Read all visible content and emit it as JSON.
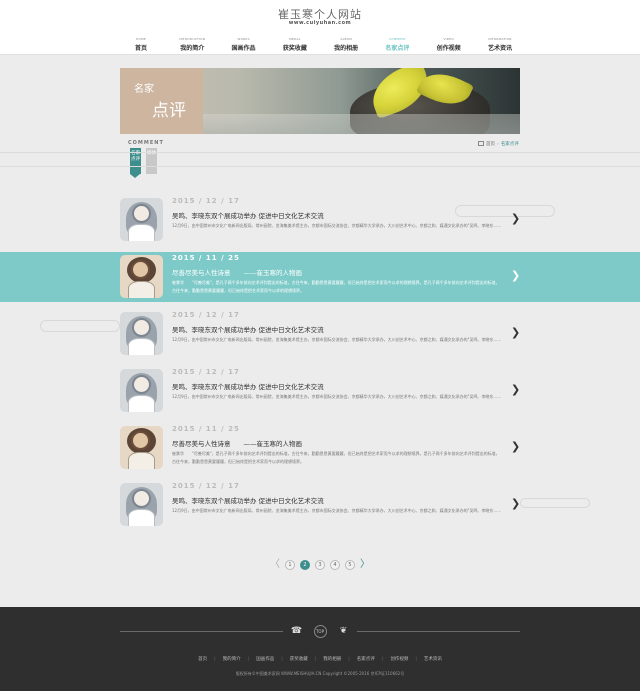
{
  "header": {
    "title": "崔玉寒个人网站",
    "url": "www.cuiyuhan.com",
    "nav": [
      {
        "en": "HOME",
        "cn": "首页",
        "active": false
      },
      {
        "en": "INTRODUCTION",
        "cn": "我的简介",
        "active": false
      },
      {
        "en": "WORKS",
        "cn": "国画作品",
        "active": false
      },
      {
        "en": "MEDAL",
        "cn": "获奖收藏",
        "active": false
      },
      {
        "en": "ALBUM",
        "cn": "我的相册",
        "active": false
      },
      {
        "en": "COMMENT",
        "cn": "名家点评",
        "active": true
      },
      {
        "en": "VIDEO",
        "cn": "创作视频",
        "active": false
      },
      {
        "en": "INFORMATION",
        "cn": "艺术资讯",
        "active": false
      }
    ]
  },
  "banner": {
    "line1": "名家",
    "line2": "点评"
  },
  "subheader": {
    "section_en": "COMMENT",
    "tab_active": "名家点评",
    "tab_other": "媒体"
  },
  "breadcrumb": {
    "home": "首页",
    "current": "名家点评"
  },
  "items": [
    {
      "date": "2015 / 12 / 17",
      "title": "吴鸣、李晓东双个展成功举办 促进中日文化艺术交流",
      "desc": "12月9日，由中国常州市文化广电新闻出版局、常州画院、览海集美术馆主办，京都市国际交流协会、京都精华大学承办，大川创艺术中心、京都之和、媒通文化承办的\"吴鸣、李晓东......",
      "style": "lady",
      "highlight": false
    },
    {
      "date": "2015 / 11 / 25",
      "title": "尽善尽美与人性诗意　　——崔玉寒的人物画",
      "desc": "崔景华　　\"尽善尽美\"，是孔子两千多年前向艺术评判提出的标准，古往今来，勤勤恳恳黄要履履，但已始终是把艺术家而今以求的理想境界。是孔子两千多年前向艺术评判提出的标准，古往今来，勤勤恳恳黄要履履，但已始终是把艺术家而今以求的理想境界。",
      "style": "old",
      "highlight": true
    },
    {
      "date": "2015 / 12 / 17",
      "title": "吴鸣、李晓东双个展成功举办 促进中日文化艺术交流",
      "desc": "12月9日，由中国常州市文化广电新闻出版局、常州画院、览海集美术馆主办，京都市国际交流协会、京都精华大学承办，大川创艺术中心、京都之和、媒通文化承办的\"吴鸣、李晓东......",
      "style": "lady",
      "highlight": false
    },
    {
      "date": "2015 / 12 / 17",
      "title": "吴鸣、李晓东双个展成功举办 促进中日文化艺术交流",
      "desc": "12月9日，由中国常州市文化广电新闻出版局、常州画院、览海集美术馆主办，京都市国际交流协会、京都精华大学承办，大川创艺术中心、京都之和、媒通文化承办的\"吴鸣、李晓东......",
      "style": "lady",
      "highlight": false
    },
    {
      "date": "2015 / 11 / 25",
      "title": "尽善尽美与人性诗意　　——崔玉寒的人物画",
      "desc": "崔景华　　\"尽善尽美\"，是孔子两千多年前向艺术评判提出的标准，古往今来，勤勤恳恳黄要履履，但已始终是把艺术家而今以求的理想境界。是孔子两千多年前向艺术评判提出的标准，古往今来，勤勤恳恳黄要履履，但已始终是把艺术家而今以求的理想境界。",
      "style": "old",
      "highlight": false
    },
    {
      "date": "2015 / 12 / 17",
      "title": "吴鸣、李晓东双个展成功举办 促进中日文化艺术交流",
      "desc": "12月9日，由中国常州市文化广电新闻出版局、常州画院、览海集美术馆主办，京都市国际交流协会、京都精华大学承办，大川创艺术中心、京都之和、媒通文化承办的\"吴鸣、李晓东......",
      "style": "lady",
      "highlight": false
    }
  ],
  "pager": {
    "prev": "〈",
    "next": "〉",
    "pages": [
      "1",
      "2",
      "3",
      "4",
      "5"
    ],
    "current": "2"
  },
  "footer": {
    "phone_icon": "phone-icon",
    "top_label": "TOP",
    "wechat_icon": "wechat-icon",
    "nav": [
      "首页",
      "我的简介",
      "国画作品",
      "获奖收藏",
      "我的相册",
      "名家点评",
      "创作视频",
      "艺术资讯"
    ],
    "copyright": "版权所有©中国美术家网 WWW.MEISHUJIA.CN Copyright ©2005-2016 京ICP证110662号"
  },
  "colors": {
    "accent": "#3f8e8e",
    "highlight": "#7ecac8",
    "footer": "#2f2f2f"
  }
}
